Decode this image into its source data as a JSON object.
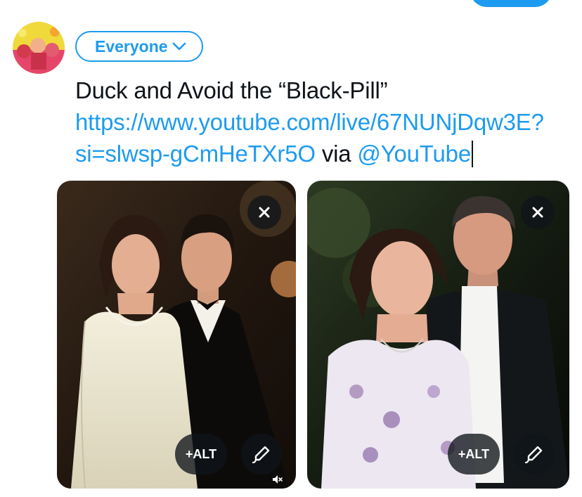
{
  "compose": {
    "audience_label": "Everyone",
    "text_before_link": "Duck and Avoid the “Black-Pill” ",
    "link_url": "https://www.youtube.com/live/67NUNjDqw3E?si=slwsp-gCmHeTXr5O",
    "text_via": " via ",
    "mention": "@YouTube"
  },
  "media": [
    {
      "alt_label": "+ALT",
      "remove_icon": "close-icon",
      "edit_icon": "edit-pencil-icon"
    },
    {
      "alt_label": "+ALT",
      "remove_icon": "close-icon",
      "edit_icon": "edit-pencil-icon"
    }
  ],
  "colors": {
    "accent": "#1d9bf0",
    "text": "#0f1419",
    "overlay": "#0f1419"
  }
}
